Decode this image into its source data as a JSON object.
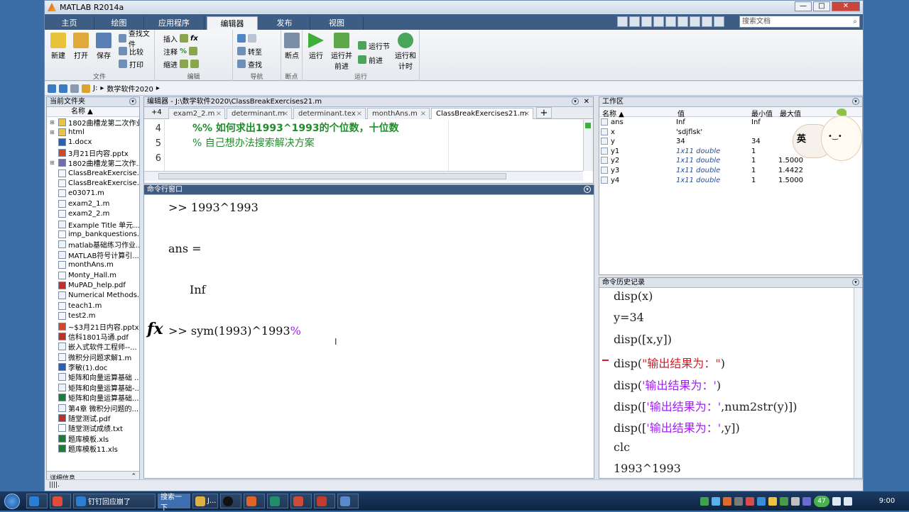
{
  "window": {
    "title": "MATLAB R2014a",
    "controls": [
      "—",
      "□",
      "✕"
    ]
  },
  "menu_tabs": [
    "主页",
    "绘图",
    "应用程序",
    "编辑器",
    "发布",
    "视图"
  ],
  "active_tab": "编辑器",
  "search_placeholder": "搜索文档",
  "ribbon": {
    "file": {
      "group": "文件",
      "new": "新建",
      "open": "打开",
      "save": "保存",
      "find_files": "查找文件",
      "compare": "比较",
      "print": "打印"
    },
    "edit": {
      "group": "编辑",
      "insert": "插入",
      "comment": "注释",
      "indent": "缩进"
    },
    "navigate": {
      "group": "导航",
      "goto": "转至",
      "find": "查找"
    },
    "breakpoints": {
      "group": "断点",
      "bp": "断点"
    },
    "run": {
      "group": "运行",
      "run": "运行",
      "run_advance": "运行并\n前进",
      "run_section": "运行节",
      "advance": "前进",
      "run_time": "运行和\n计时"
    }
  },
  "address": {
    "path": [
      "J:",
      "数学软件2020"
    ]
  },
  "current_folder": {
    "title": "当前文件夹",
    "col_name": "名称 ▲",
    "files": [
      {
        "name": "1802曲槽龙第二次作业",
        "type": "folder",
        "exp": "⊞"
      },
      {
        "name": "html",
        "type": "folder",
        "exp": "⊞"
      },
      {
        "name": "1.docx",
        "type": "doc",
        "exp": ""
      },
      {
        "name": "3月21日内容.pptx",
        "type": "ppt",
        "exp": ""
      },
      {
        "name": "1802曲槽龙第二次作...",
        "type": "zip",
        "exp": "⊞"
      },
      {
        "name": "ClassBreakExercise...",
        "type": "m",
        "exp": ""
      },
      {
        "name": "ClassBreakExercise...",
        "type": "m",
        "exp": ""
      },
      {
        "name": "e03071.m",
        "type": "m",
        "exp": ""
      },
      {
        "name": "exam2_1.m",
        "type": "fn",
        "exp": ""
      },
      {
        "name": "exam2_2.m",
        "type": "fn",
        "exp": ""
      },
      {
        "name": "Example Title 单元...",
        "type": "pub",
        "exp": ""
      },
      {
        "name": "imp_bankquestions...",
        "type": "txt",
        "exp": ""
      },
      {
        "name": "matlab基础练习作业...",
        "type": "pub",
        "exp": ""
      },
      {
        "name": "MATLAB符号计算引...",
        "type": "pub",
        "exp": ""
      },
      {
        "name": "monthAns.m",
        "type": "m",
        "exp": ""
      },
      {
        "name": "Monty_Hall.m",
        "type": "m",
        "exp": ""
      },
      {
        "name": "MuPAD_help.pdf",
        "type": "pdf",
        "exp": ""
      },
      {
        "name": "Numerical Methods...",
        "type": "pub",
        "exp": ""
      },
      {
        "name": "teach1.m",
        "type": "m",
        "exp": ""
      },
      {
        "name": "test2.m",
        "type": "m",
        "exp": ""
      },
      {
        "name": "~$3月21日内容.pptx",
        "type": "ppt",
        "exp": ""
      },
      {
        "name": "信科1801马通.pdf",
        "type": "pdf",
        "exp": ""
      },
      {
        "name": "嵌入式软件工程师--...",
        "type": "pub",
        "exp": ""
      },
      {
        "name": "微积分问题求解1.m",
        "type": "m",
        "exp": ""
      },
      {
        "name": "李敏(1).doc",
        "type": "doc",
        "exp": ""
      },
      {
        "name": "矩阵和向量运算基础 ...",
        "type": "pub",
        "exp": ""
      },
      {
        "name": "矩阵和向量运算基础-...",
        "type": "pub",
        "exp": ""
      },
      {
        "name": "矩阵和向量运算基础...",
        "type": "xls",
        "exp": ""
      },
      {
        "name": "第4章 微积分问题的...",
        "type": "pub",
        "exp": ""
      },
      {
        "name": "随堂测试.pdf",
        "type": "pdf",
        "exp": ""
      },
      {
        "name": "随堂测试成绩.txt",
        "type": "txt",
        "exp": ""
      },
      {
        "name": "题库模板.xls",
        "type": "xls",
        "exp": ""
      },
      {
        "name": "题库模板11.xls",
        "type": "xls",
        "exp": ""
      }
    ],
    "details": "详细信息"
  },
  "editor": {
    "title": "编辑器 - J:\\数学软件2020\\ClassBreakExercises21.m",
    "tabs": [
      "exam2_2.m",
      "determinant.m",
      "determinant.tex",
      "monthAns.m",
      "ClassBreakExercises21.m"
    ],
    "tab_count": "+4",
    "lines": [
      {
        "num": "4",
        "text": "%% 如何求出1993^1993的个位数，十位数"
      },
      {
        "num": "5",
        "text": "% 自己想办法搜索解决方案"
      },
      {
        "num": "6",
        "text": ""
      }
    ]
  },
  "command_window": {
    "title": "命令行窗口",
    "lines": [
      ">> 1993^1993",
      "ans =",
      "Inf"
    ],
    "prompt": ">> sym(1993)^1993",
    "partial": "%",
    "fx": "fx"
  },
  "workspace": {
    "title": "工作区",
    "cols": [
      "名称 ▲",
      "值",
      "最小值",
      "最大值"
    ],
    "vars": [
      {
        "name": "ans",
        "value": "Inf",
        "min": "Inf",
        "max": "",
        "italic": false
      },
      {
        "name": "x",
        "value": "'sdjflsk'",
        "min": "",
        "max": "",
        "italic": false
      },
      {
        "name": "y",
        "value": "34",
        "min": "34",
        "max": "",
        "italic": false
      },
      {
        "name": "y1",
        "value": "1x11 double",
        "min": "1",
        "max": "",
        "italic": true
      },
      {
        "name": "y2",
        "value": "1x11 double",
        "min": "1",
        "max": "1.5000",
        "italic": true
      },
      {
        "name": "y3",
        "value": "1x11 double",
        "min": "1",
        "max": "1.4422",
        "italic": true
      },
      {
        "name": "y4",
        "value": "1x11 double",
        "min": "1",
        "max": "1.5000",
        "italic": true
      }
    ]
  },
  "history": {
    "title": "命令历史记录",
    "entries": [
      {
        "pre": "disp(x)",
        "str": "",
        "post": ""
      },
      {
        "pre": "y=34",
        "str": "",
        "post": ""
      },
      {
        "pre": "disp([x,y])",
        "str": "",
        "post": ""
      },
      {
        "pre": "disp(",
        "str": "\"输出结果为：\"",
        "post": ")",
        "err": true
      },
      {
        "pre": "disp(",
        "str": "'输出结果为：'",
        "post": ")"
      },
      {
        "pre": "disp([",
        "str": "'输出结果为：'",
        "post": ",num2str(y)])"
      },
      {
        "pre": "disp([",
        "str": "'输出结果为：'",
        "post": ",y])"
      },
      {
        "pre": "clc",
        "str": "",
        "post": ""
      },
      {
        "pre": "1993^1993",
        "str": "",
        "post": ""
      }
    ]
  },
  "sticker": {
    "text": "英"
  },
  "taskbar": {
    "items": [
      "钉钉回应崩了",
      "搜索一下",
      "J..."
    ],
    "badge": "47",
    "time": "9:00"
  }
}
